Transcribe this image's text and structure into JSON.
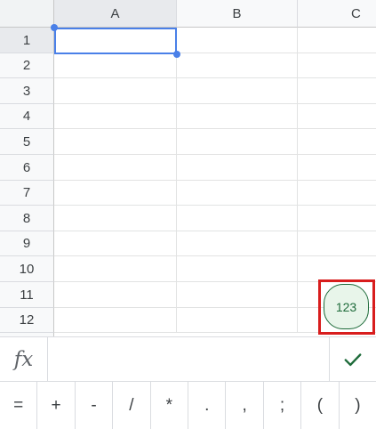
{
  "sheet": {
    "columns": [
      "A",
      "B",
      "C"
    ],
    "rows": [
      "1",
      "2",
      "3",
      "4",
      "5",
      "6",
      "7",
      "8",
      "9",
      "10",
      "11",
      "12"
    ],
    "selected_cell": "A1"
  },
  "keyboard_toggle": {
    "label": "123"
  },
  "formula_bar": {
    "fx_label": "fx",
    "value": "",
    "confirm_icon": "check-icon"
  },
  "symbol_keys": [
    "=",
    "+",
    "-",
    "/",
    "*",
    ".",
    ",",
    ";",
    "(",
    ")"
  ],
  "colors": {
    "selection": "#4a80e8",
    "accent_green": "#1e6b3a",
    "highlight": "#d81d1d"
  }
}
